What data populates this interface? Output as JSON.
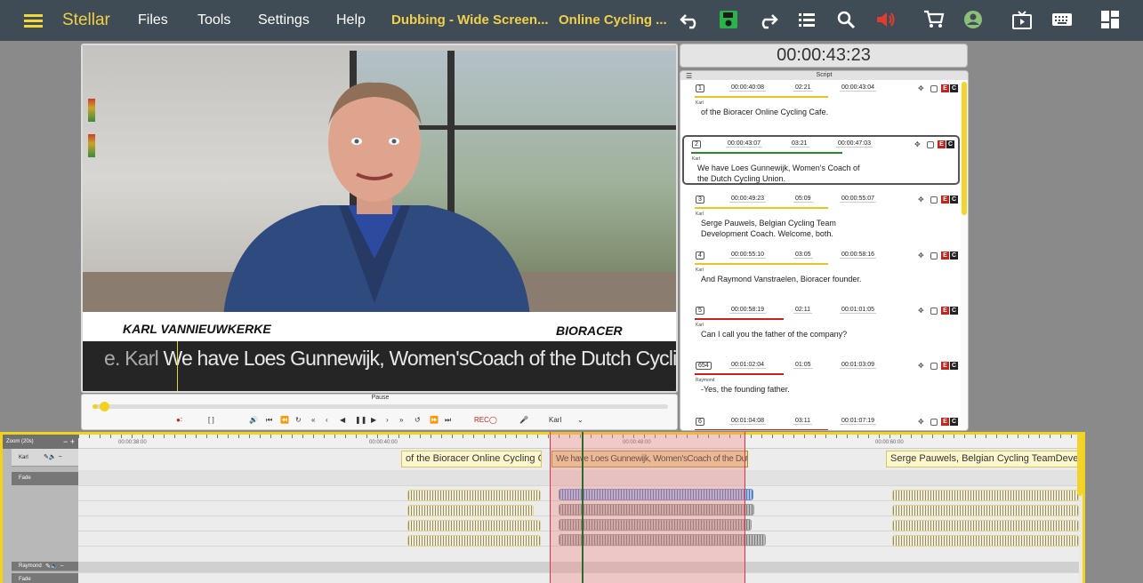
{
  "app": {
    "name": "Stellar"
  },
  "menu": [
    "Files",
    "Tools",
    "Settings",
    "Help"
  ],
  "projects": [
    "Dubbing - Wide Screen...",
    "Online Cycling ..."
  ],
  "toolbar_icons": [
    "undo-icon",
    "save-icon",
    "redo-icon",
    "list-icon",
    "search-icon",
    "volume-icon",
    "cart-icon",
    "user-icon",
    "tv-icon",
    "keyboard-icon",
    "dashboard-icon"
  ],
  "video": {
    "lower_third_name": "KARL VANNIEUWKERKE",
    "lower_third_logo": "BIORACER",
    "subtitle_prev": "e.  Karl",
    "subtitle": "We have Loes Gunnewijk, Women'sCoach of the Dutch Cycling Union."
  },
  "transport": {
    "state": "Pause",
    "progress": 0.01,
    "rec": "REC",
    "speaker": "Karl",
    "brackets": "[    ]"
  },
  "timecode": "00:00:43:23",
  "script": {
    "title": "Script",
    "lines": [
      {
        "num": "1",
        "in": "00:00:40:08",
        "dur": "02:21",
        "out": "00:00:43:04",
        "speaker": "Karl",
        "text": "of the Bioracer Online Cycling Cafe.",
        "color": "#e8c620"
      },
      {
        "num": "2",
        "in": "00:00:43:07",
        "dur": "03:21",
        "out": "00:00:47:03",
        "speaker": "Karl",
        "text": "We have Loes Gunnewijk, Women's Coach of the Dutch Cycling Union.",
        "color": "#2a8a2a"
      },
      {
        "num": "3",
        "in": "00:00:49:23",
        "dur": "05:09",
        "out": "00:00:55:07",
        "speaker": "Karl",
        "text": "Serge Pauwels, Belgian Cycling Team Development Coach. Welcome, both.",
        "color": "#e8c620"
      },
      {
        "num": "4",
        "in": "00:00:55:10",
        "dur": "03:05",
        "out": "00:00:58:16",
        "speaker": "Karl",
        "text": "And Raymond Vanstraelen, Bioracer founder.",
        "color": "#e8c620"
      },
      {
        "num": "5",
        "in": "00:00:58:19",
        "dur": "02:11",
        "out": "00:01:01:05",
        "speaker": "Karl",
        "text": "Can I call you the father of the company?",
        "color": "#c7221b"
      },
      {
        "num": "654",
        "in": "00:01:02:04",
        "dur": "01:05",
        "out": "00:01:03:09",
        "speaker": "Raymond",
        "text": "-Yes, the founding father.",
        "color": "#c7221b"
      },
      {
        "num": "6",
        "in": "00:01:04:08",
        "dur": "03:11",
        "out": "00:01:07:19",
        "speaker": "",
        "text": "",
        "color": "#c7221b"
      }
    ]
  },
  "timeline": {
    "zoom": "Zoom (20s)",
    "ruler": [
      "00:00:38:00",
      "00:00:40:00",
      "00:00:48:00",
      "00:00:60:00"
    ],
    "tracks": [
      {
        "name": "Karl",
        "fade": "Fade"
      },
      {
        "name": "Raymond",
        "fade": "Fade"
      }
    ],
    "clips": [
      "of the Bioracer Online Cycling Cafe.",
      "We have Loes Gunnewijk, Women'sCoach of the Dutch Cycling Union.",
      "Serge Pauwels, Belgian Cycling TeamDevelopment Coach. Welcome, both."
    ]
  }
}
